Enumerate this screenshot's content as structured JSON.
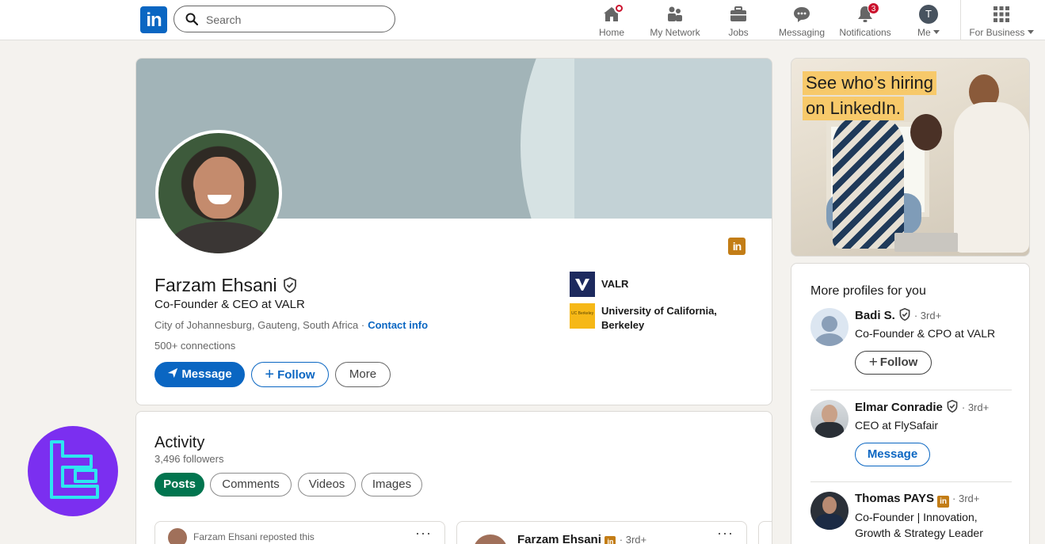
{
  "nav": {
    "logo_text": "in",
    "search_placeholder": "Search",
    "items": [
      {
        "label": "Home",
        "icon": "home-icon"
      },
      {
        "label": "My Network",
        "icon": "network-icon"
      },
      {
        "label": "Jobs",
        "icon": "briefcase-icon"
      },
      {
        "label": "Messaging",
        "icon": "messaging-icon"
      },
      {
        "label": "Notifications",
        "icon": "bell-icon",
        "badge": "3"
      },
      {
        "label": "Me",
        "icon": "avatar",
        "avatar_letter": "T"
      },
      {
        "label": "For Business",
        "icon": "grid-icon"
      }
    ]
  },
  "profile": {
    "name": "Farzam Ehsani",
    "headline": "Co-Founder & CEO at VALR",
    "location": "City of Johannesburg, Gauteng, South Africa ·",
    "contact_info": "Contact info",
    "connections": "500+ connections",
    "buttons": {
      "message": "Message",
      "follow": "Follow",
      "more": "More"
    },
    "experience": [
      {
        "label": "VALR"
      },
      {
        "label": "University of California, Berkeley",
        "logo_text": "UC Berkeley"
      }
    ]
  },
  "activity": {
    "title": "Activity",
    "followers": "3,496 followers",
    "tabs": [
      "Posts",
      "Comments",
      "Videos",
      "Images"
    ],
    "posts": [
      {
        "author_line": "Farzam Ehsani reposted this"
      },
      {
        "author": "Farzam Ehsani",
        "degree": "· 3rd+"
      }
    ]
  },
  "ad": {
    "headline_line1": "See who’s hiring",
    "headline_line2": "on LinkedIn."
  },
  "more_profiles": {
    "title": "More profiles for you",
    "people": [
      {
        "name": "Badi S.",
        "degree": "· 3rd+",
        "headline": "Co-Founder & CPO at VALR",
        "action": "Follow"
      },
      {
        "name": "Elmar Conradie",
        "degree": "· 3rd+",
        "headline": "CEO at FlySafair",
        "action": "Message"
      },
      {
        "name": "Thomas PAYS",
        "degree": "· 3rd+",
        "headline": "Co-Founder | Innovation, Growth & Strategy Leader"
      }
    ]
  },
  "colors": {
    "brand": "#0a66c2",
    "active_tab": "#01754f",
    "badge": "#cb112d",
    "premium": "#c37d16"
  }
}
